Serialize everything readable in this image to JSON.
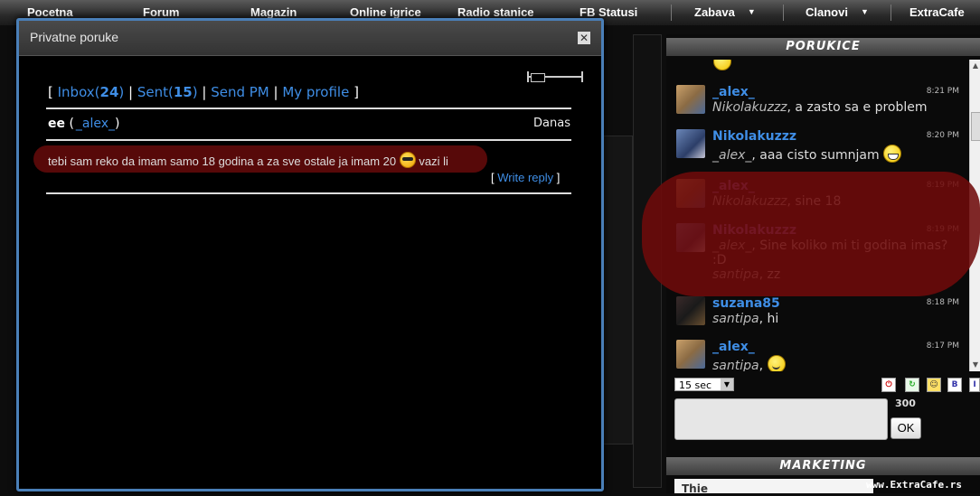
{
  "nav": {
    "items": [
      "Pocetna",
      "Forum",
      "Magazin",
      "Online igrice",
      "Radio stanice",
      "FB Statusi",
      "Zabava",
      "Clanovi",
      "ExtraCafe"
    ],
    "caret": "▼"
  },
  "modal": {
    "title": "Privatne poruke",
    "close": "✕",
    "nav": {
      "inbox_label": "Inbox",
      "inbox_count": "24",
      "sent_label": "Sent",
      "sent_count": "15",
      "send_pm": "Send PM",
      "my_profile": "My profile"
    },
    "message": {
      "subject": "ee",
      "from": "_alex_",
      "date": "Danas",
      "body_before": "tebi sam reko da imam samo 18 godina a za sve ostale ja imam 20",
      "body_after": "vazi li",
      "emoticon": "cool-smiley-icon",
      "write_reply": "Write reply"
    }
  },
  "sidebar": {
    "chat_title": "PORUKICE",
    "marketing_title": "MARKETING",
    "messages": [
      {
        "name": "_alex_",
        "time": "8:21 PM",
        "to": "Nikolakuzzz",
        "text": ", a zasto sa e problem",
        "name_color": "blue",
        "avatar": "photo"
      },
      {
        "name": "Nikolakuzzz",
        "time": "8:20 PM",
        "to": "_alex_",
        "text": ", aaa cisto sumnjam",
        "name_color": "blue",
        "avatar": "blue",
        "emoticon": "grin"
      },
      {
        "name": "_alex_",
        "time": "8:19 PM",
        "to": "Nikolakuzzz",
        "text": ", sine 18",
        "name_color": "purple",
        "avatar": "photo"
      },
      {
        "name": "Nikolakuzzz",
        "time": "8:19 PM",
        "to": "_alex_",
        "text": ", Sine koliko mi ti godina imas? :D",
        "to2": "santipa",
        "text2": ", zz",
        "name_color": "purple",
        "avatar": "blue"
      },
      {
        "name": "suzana85",
        "time": "8:18 PM",
        "to": "santipa",
        "text": ", hi",
        "name_color": "blue",
        "avatar": "dark"
      },
      {
        "name": "_alex_",
        "time": "8:17 PM",
        "to": "santipa",
        "text": ",",
        "name_color": "blue",
        "avatar": "photo",
        "emoticon": "smile"
      }
    ],
    "refresh_interval": "15 sec",
    "char_counter": "300",
    "send_button": "OK",
    "ad_text": "Thie"
  },
  "watermark": "www.ExtraCafe.rs",
  "colors": {
    "link": "#3f8ee6",
    "modal_border": "#4a7fb8",
    "highlight": "#5c0a0a"
  }
}
